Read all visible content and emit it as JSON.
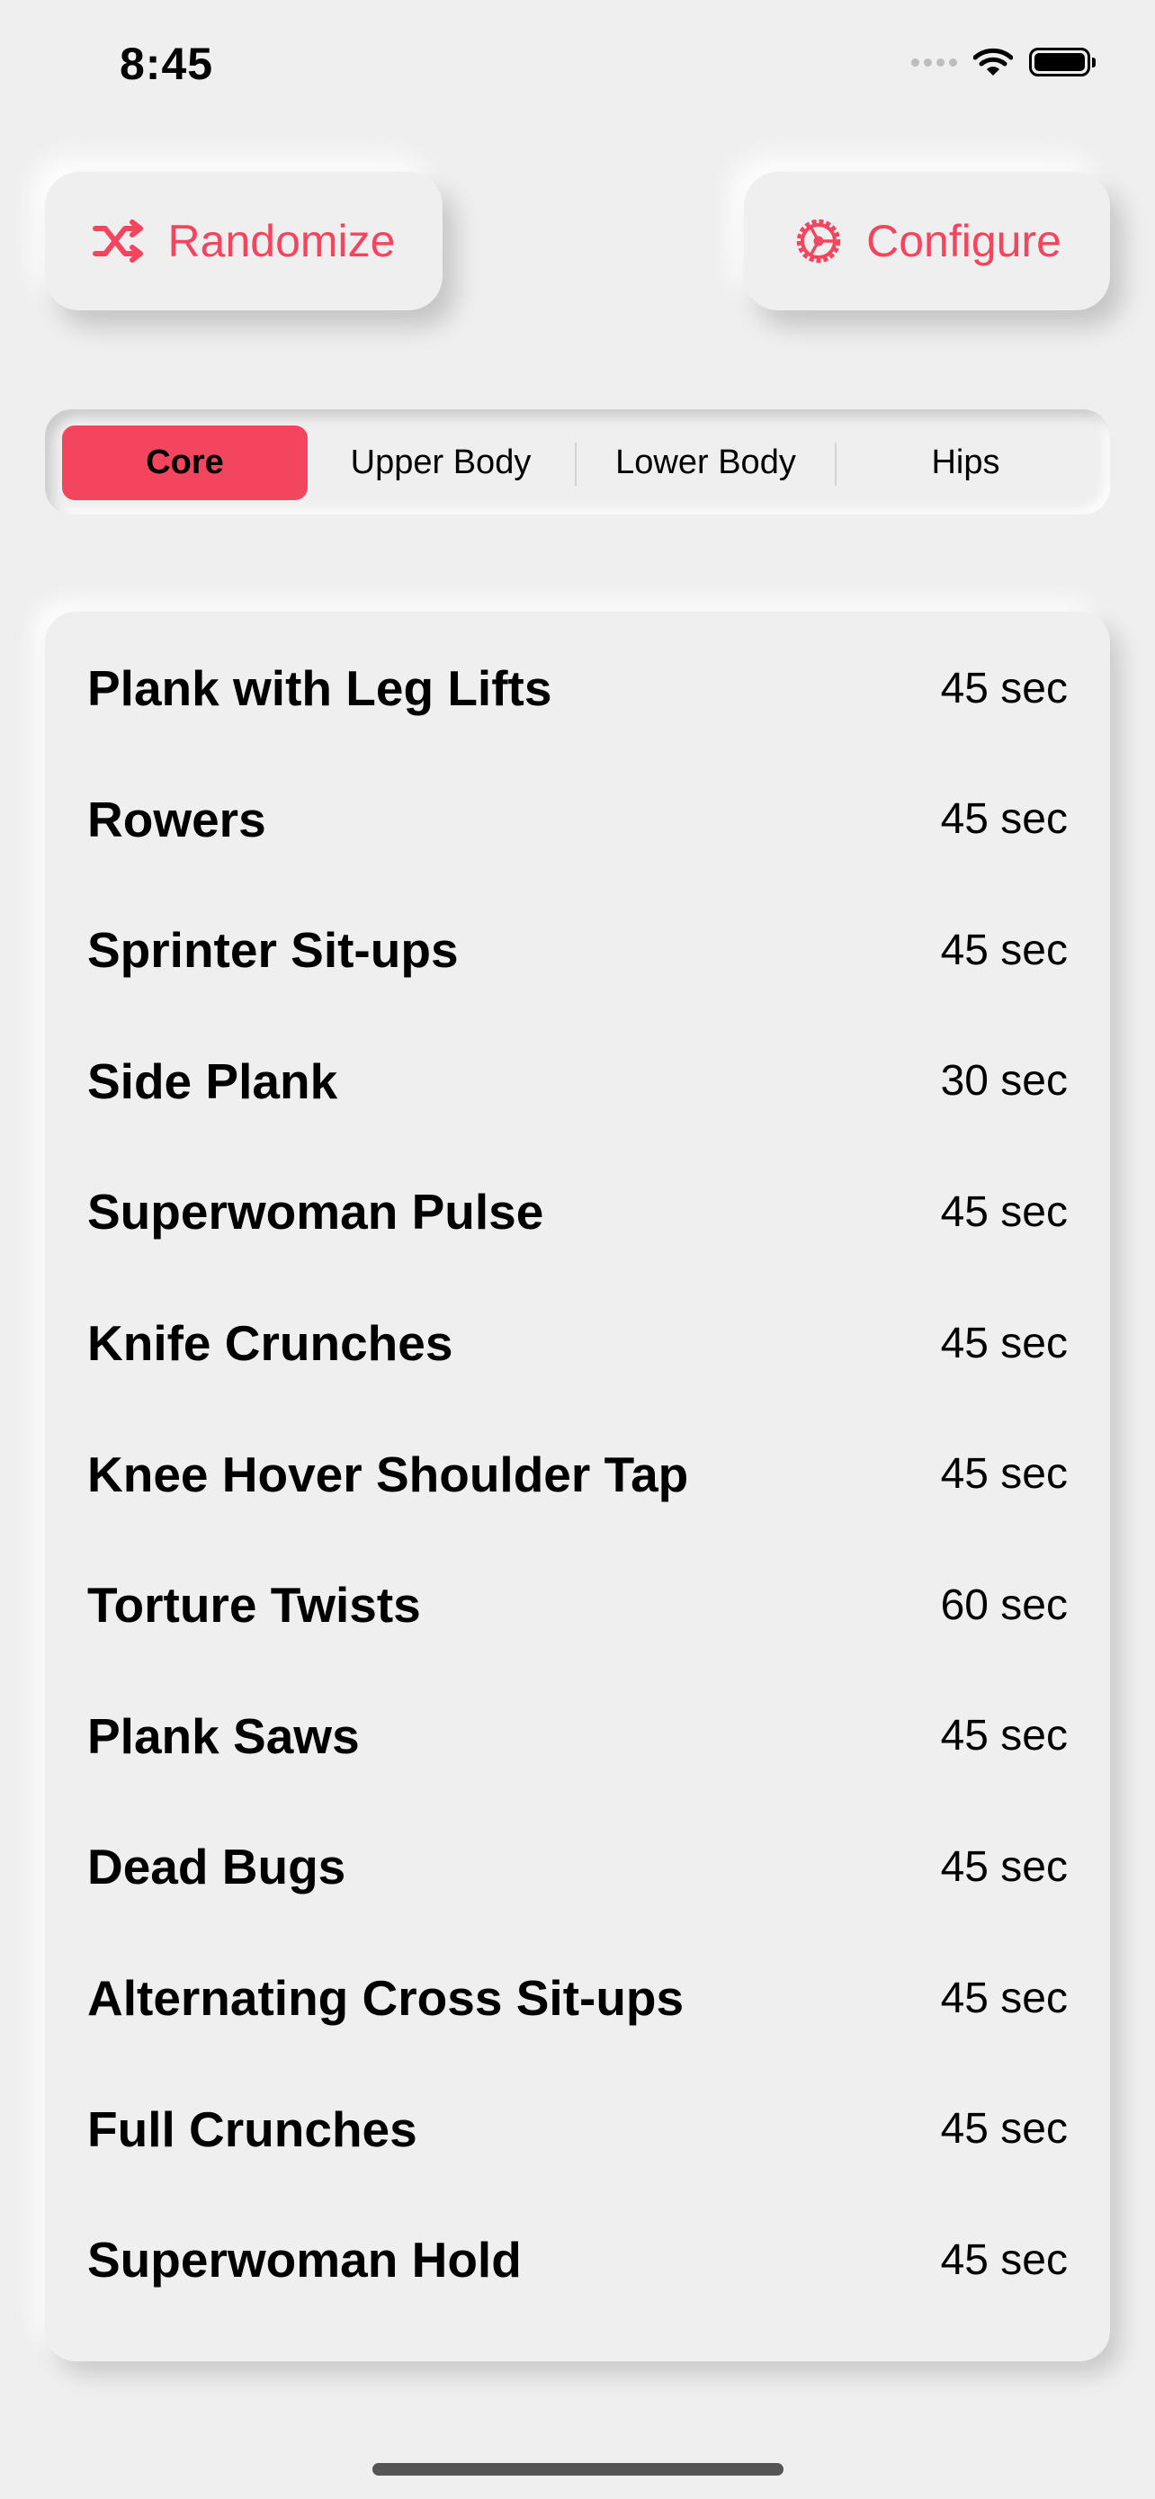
{
  "status_bar": {
    "time": "8:45"
  },
  "toolbar": {
    "randomize_label": "Randomize",
    "configure_label": "Configure",
    "accent": "#f4455f"
  },
  "segments": [
    {
      "label": "Core",
      "selected": true
    },
    {
      "label": "Upper Body",
      "selected": false
    },
    {
      "label": "Lower Body",
      "selected": false
    },
    {
      "label": "Hips",
      "selected": false
    }
  ],
  "exercises": [
    {
      "name": "Plank with Leg Lifts",
      "duration": "45 sec"
    },
    {
      "name": "Rowers",
      "duration": "45 sec"
    },
    {
      "name": "Sprinter Sit-ups",
      "duration": "45 sec"
    },
    {
      "name": "Side Plank",
      "duration": "30 sec"
    },
    {
      "name": "Superwoman Pulse",
      "duration": "45 sec"
    },
    {
      "name": "Knife Crunches",
      "duration": "45 sec"
    },
    {
      "name": "Knee Hover Shoulder Tap",
      "duration": "45 sec"
    },
    {
      "name": "Torture Twists",
      "duration": "60 sec"
    },
    {
      "name": "Plank Saws",
      "duration": "45 sec"
    },
    {
      "name": "Dead Bugs",
      "duration": "45 sec"
    },
    {
      "name": "Alternating Cross Sit-ups",
      "duration": "45 sec"
    },
    {
      "name": "Full Crunches",
      "duration": "45 sec"
    },
    {
      "name": "Superwoman Hold",
      "duration": "45 sec"
    }
  ]
}
